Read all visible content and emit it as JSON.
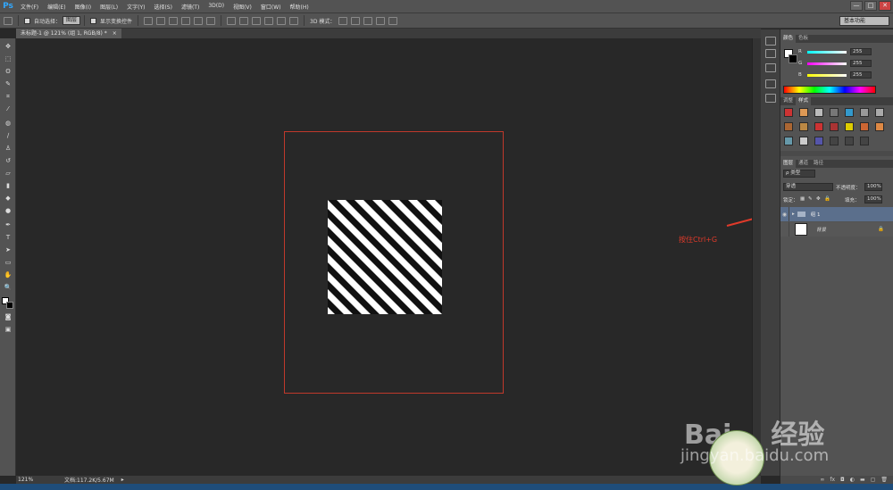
{
  "app": {
    "logo": "Ps",
    "menu": [
      "文件(F)",
      "编辑(E)",
      "图像(I)",
      "图层(L)",
      "文字(Y)",
      "选择(S)",
      "滤镜(T)",
      "3D(D)",
      "视图(V)",
      "窗口(W)",
      "帮助(H)"
    ],
    "window_controls": [
      "—",
      "□",
      "✕"
    ]
  },
  "options_bar": {
    "auto_select_label": "自动选择：",
    "auto_select_value": "图层",
    "show_transform_label": "显示变换控件",
    "mode_3d_label": "3D 模式：",
    "workspace": "基本功能"
  },
  "document": {
    "tab_title": "未标题-1 @ 121% (组 1, RGB/8) *",
    "close_glyph": "×"
  },
  "canvas": {
    "annotation": "按住Ctrl+G",
    "annotation_color": "#e03a2a",
    "frame_color": "#c0392b"
  },
  "status": {
    "zoom": "121%",
    "doc_size": "文档:117.2K/5.67M"
  },
  "panels": {
    "color": {
      "tabs": [
        "颜色",
        "色板"
      ],
      "channels": [
        {
          "label": "R",
          "value": "255"
        },
        {
          "label": "G",
          "value": "255"
        },
        {
          "label": "B",
          "value": "255"
        }
      ]
    },
    "styles": {
      "tabs": [
        "调整",
        "样式"
      ]
    },
    "layers": {
      "tabs": [
        "图层",
        "通道",
        "路径"
      ],
      "filter": "ρ 类型",
      "blend_mode": "穿透",
      "opacity_label": "不透明度：",
      "opacity_value": "100%",
      "lock_label": "锁定：",
      "fill_label": "填充：",
      "fill_value": "100%",
      "rows": [
        {
          "name": "组 1",
          "type": "group"
        },
        {
          "name": "背景",
          "type": "background"
        }
      ]
    }
  },
  "watermark": {
    "brand": "Bai",
    "brand_suffix": "经验",
    "url": "jingyan.baidu.com"
  }
}
